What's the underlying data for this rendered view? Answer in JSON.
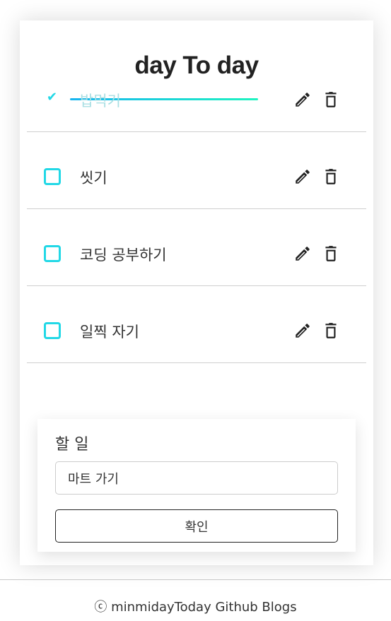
{
  "title": "day To day",
  "todos": [
    {
      "text": "밥먹기",
      "done": true
    },
    {
      "text": "씻기",
      "done": false
    },
    {
      "text": "코딩 공부하기",
      "done": false
    },
    {
      "text": "일찍 자기",
      "done": false
    }
  ],
  "form": {
    "label": "할 일",
    "input_value": "마트 가기",
    "submit_label": "확인"
  },
  "footer": "ⓒ minmidayToday Github Blogs",
  "colors": {
    "accent": "#22d8e6"
  }
}
